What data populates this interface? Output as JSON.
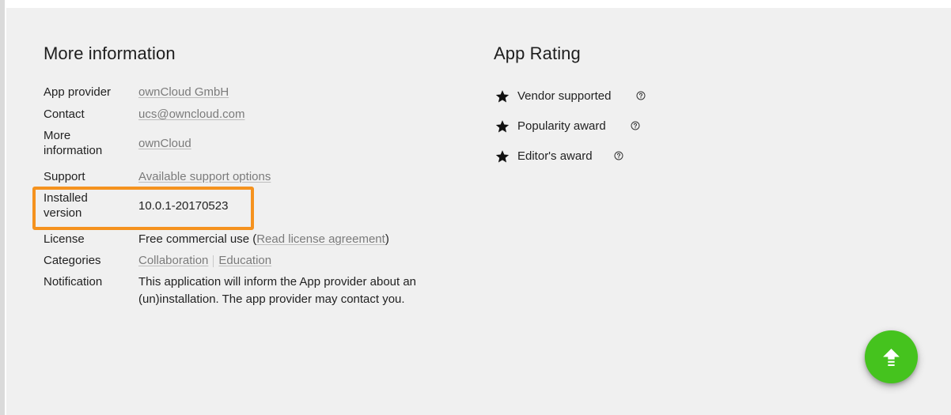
{
  "more_information": {
    "title": "More information",
    "rows": [
      {
        "key": "App provider",
        "value": "ownCloud GmbH",
        "link": true
      },
      {
        "key": "Contact",
        "value": "ucs@owncloud.com",
        "link": true
      },
      {
        "key": "More information",
        "value": "ownCloud",
        "link": true
      },
      {
        "key": "Support",
        "value": "Available support options",
        "link": true
      },
      {
        "key": "Installed version",
        "value": "10.0.1-20170523",
        "link": false
      },
      {
        "key": "License",
        "value_prefix": "Free commercial use (",
        "value_link": "Read license agreement",
        "value_suffix": ")"
      },
      {
        "key": "Categories",
        "values": [
          "Collaboration",
          "Education"
        ]
      },
      {
        "key": "Notification",
        "value": "This application will inform the App provider about an (un)installation. The app provider may contact you."
      }
    ]
  },
  "app_rating": {
    "title": "App Rating",
    "items": [
      {
        "label": "Vendor supported",
        "icon": "star-icon",
        "help_icon": "help-circle-icon"
      },
      {
        "label": "Popularity award",
        "icon": "star-icon",
        "help_icon": "help-circle-icon"
      },
      {
        "label": "Editor's award",
        "icon": "star-icon",
        "help_icon": "help-circle-icon"
      }
    ]
  },
  "fab": {
    "icon": "upload-arrow-icon"
  },
  "colors": {
    "highlight": "#f5921e",
    "fab": "#45c31e",
    "link": "#7b7b7b",
    "panel": "#f0f0f0"
  }
}
